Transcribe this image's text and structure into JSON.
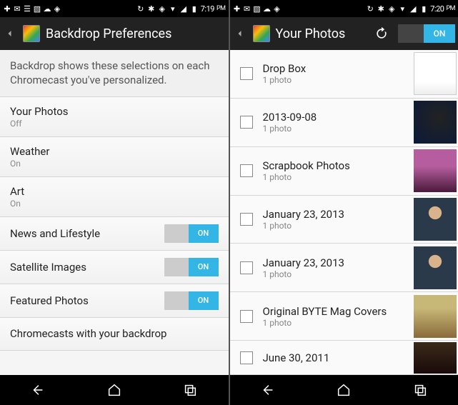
{
  "left": {
    "status": {
      "time": "7:19",
      "ampm": "PM"
    },
    "actionbar": {
      "title": "Backdrop Preferences"
    },
    "description": "Backdrop shows these selections on each Chromecast you've personalized.",
    "prefs": [
      {
        "title": "Your Photos",
        "sub": "Off"
      },
      {
        "title": "Weather",
        "sub": "On"
      },
      {
        "title": "Art",
        "sub": "On"
      },
      {
        "title": "News and Lifestyle",
        "toggle": "ON"
      },
      {
        "title": "Satellite Images",
        "toggle": "ON"
      },
      {
        "title": "Featured Photos",
        "toggle": "ON"
      },
      {
        "title": "Chromecasts with your backdrop"
      }
    ]
  },
  "right": {
    "status": {
      "time": "7:20",
      "ampm": "PM"
    },
    "actionbar": {
      "title": "Your Photos",
      "toggle": "ON"
    },
    "albums": [
      {
        "title": "Drop Box",
        "sub": "1 photo"
      },
      {
        "title": "2013-09-08",
        "sub": "1 photo"
      },
      {
        "title": "Scrapbook Photos",
        "sub": "1 photo"
      },
      {
        "title": "January 23, 2013",
        "sub": "1 photo"
      },
      {
        "title": "January 23, 2013",
        "sub": "1 photo"
      },
      {
        "title": "Original BYTE Mag Covers",
        "sub": "1 photo"
      },
      {
        "title": "June 30, 2011",
        "sub": ""
      }
    ]
  }
}
